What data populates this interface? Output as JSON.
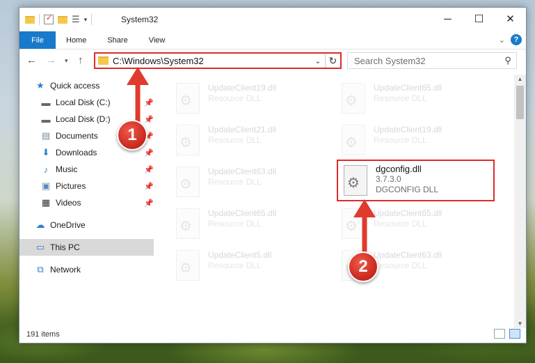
{
  "window": {
    "title": "System32",
    "controls": {
      "minimize": "─",
      "maximize": "☐",
      "close": "✕"
    }
  },
  "ribbon": {
    "file_tab": "File",
    "tabs": [
      "Home",
      "Share",
      "View"
    ]
  },
  "address": {
    "path": "C:\\Windows\\System32",
    "search_placeholder": "Search System32"
  },
  "nav": {
    "items": [
      {
        "label": "Quick access",
        "icon": "star-icon",
        "pinned": false
      },
      {
        "label": "Local Disk (C:)",
        "icon": "drive-icon",
        "pinned": true
      },
      {
        "label": "Local Disk (D:)",
        "icon": "drive-icon",
        "pinned": true
      },
      {
        "label": "Documents",
        "icon": "documents-icon",
        "pinned": true
      },
      {
        "label": "Downloads",
        "icon": "downloads-icon",
        "pinned": true
      },
      {
        "label": "Music",
        "icon": "music-icon",
        "pinned": true
      },
      {
        "label": "Pictures",
        "icon": "pictures-icon",
        "pinned": true
      },
      {
        "label": "Videos",
        "icon": "videos-icon",
        "pinned": true
      },
      {
        "label": "OneDrive",
        "icon": "cloud-icon",
        "pinned": false
      },
      {
        "label": "This PC",
        "icon": "computer-icon",
        "pinned": false,
        "selected": true
      },
      {
        "label": "Network",
        "icon": "network-icon",
        "pinned": false
      }
    ]
  },
  "files": [
    {
      "name": "UpdateClient19.dll",
      "type": "Resource DLL"
    },
    {
      "name": "UpdateClient65.dll",
      "type": "Resource DLL"
    },
    {
      "name": "UpdateClient21.dll",
      "type": "Resource DLL"
    },
    {
      "name": "UpdateClient19.dll",
      "type": "Resource DLL"
    },
    {
      "name": "UpdateClient63.dll",
      "type": "Resource DLL"
    },
    {
      "name": "dgconfig.dll",
      "version": "3.7.3.0",
      "type": "DGCONFIG DLL"
    },
    {
      "name": "UpdateClient65.dll",
      "type": "Resource DLL"
    },
    {
      "name": "UpdateClient65.dll",
      "type": "Resource DLL"
    },
    {
      "name": "UpdateClient5.dll",
      "type": "Resource DLL"
    },
    {
      "name": "UpdateClient63.dll",
      "type": "Resource DLL"
    }
  ],
  "status": {
    "item_count": "191 items"
  },
  "annotations": {
    "marker1": "1",
    "marker2": "2"
  },
  "colors": {
    "accent": "#1979ca",
    "highlight": "#e02a2a"
  }
}
